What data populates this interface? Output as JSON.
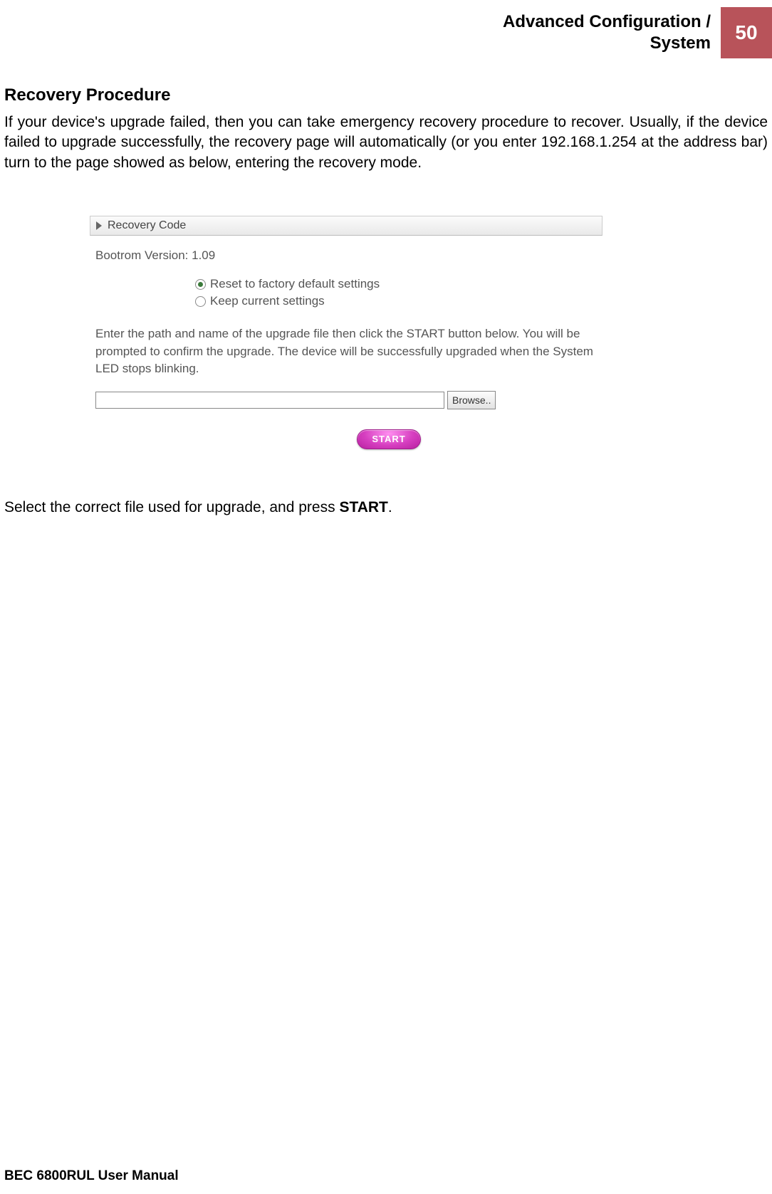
{
  "header": {
    "title_line1": "Advanced Configuration /",
    "title_line2": "System",
    "page_number": "50"
  },
  "section": {
    "heading": "Recovery Procedure",
    "paragraph": "If your device's upgrade failed, then you can take emergency recovery procedure to recover. Usually, if the device failed to upgrade successfully, the recovery page will automatically (or you enter 192.168.1.254 at the address bar) turn to the page showed as below, entering the recovery mode."
  },
  "panel": {
    "title": "Recovery Code",
    "version_label": "Bootrom Version: 1.09",
    "radio1": "Reset to factory default settings",
    "radio2": "Keep current settings",
    "instructions": "Enter the path and name of the upgrade file then click the START button below. You will be prompted to confirm the upgrade. The device will be successfully upgraded when the System LED stops blinking.",
    "browse_label": "Browse..",
    "start_label": "START"
  },
  "post_text_prefix": "Select the correct file used for upgrade, and press ",
  "post_text_bold": "START",
  "post_text_suffix": ".",
  "footer": "BEC 6800RUL User Manual"
}
